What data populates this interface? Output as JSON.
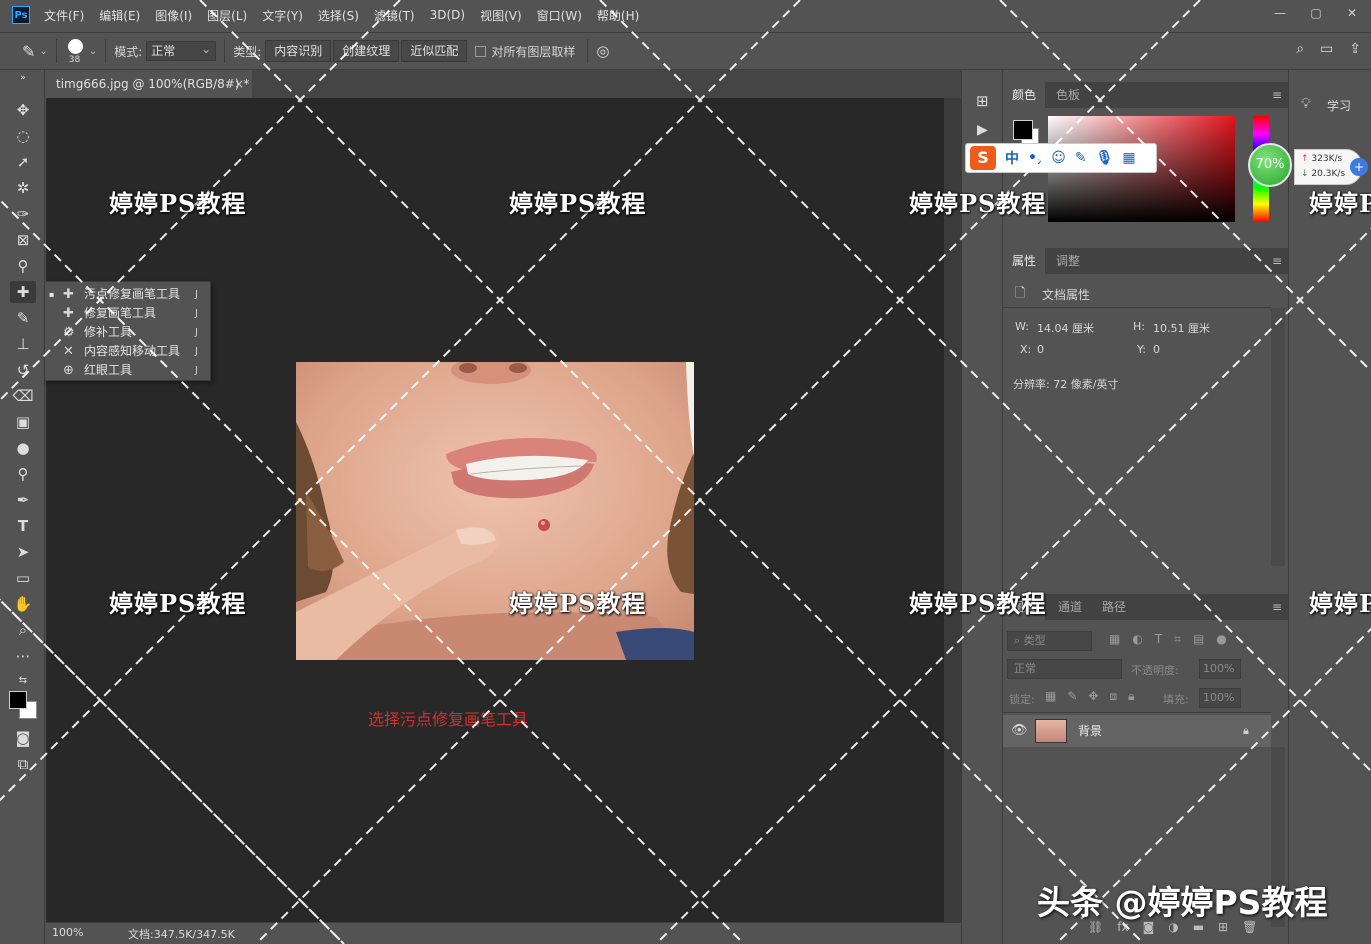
{
  "app": {
    "logo": "Ps",
    "menu": [
      "文件(F)",
      "编辑(E)",
      "图像(I)",
      "图层(L)",
      "文字(Y)",
      "选择(S)",
      "滤镜(T)",
      "3D(D)",
      "视图(V)",
      "窗口(W)",
      "帮助(H)"
    ],
    "window_controls": [
      "—",
      "▢",
      "✕"
    ]
  },
  "options": {
    "brush_size": "38",
    "mode_label": "模式:",
    "mode_value": "正常",
    "type_label": "类型:",
    "type_options": [
      "内容识别",
      "创建纹理",
      "近似匹配"
    ],
    "sample_all_label": "对所有图层取样"
  },
  "document": {
    "tab_title": "timg666.jpg @ 100%(RGB/8#) *",
    "close": "×",
    "zoom": "100%",
    "doc_size": "文档:347.5K/347.5K"
  },
  "flyout": {
    "items": [
      {
        "label": "污点修复画笔工具",
        "shortcut": "J",
        "selected": "▪"
      },
      {
        "label": "修复画笔工具",
        "shortcut": "J",
        "selected": ""
      },
      {
        "label": "修补工具",
        "shortcut": "J",
        "selected": ""
      },
      {
        "label": "内容感知移动工具",
        "shortcut": "J",
        "selected": ""
      },
      {
        "label": "红眼工具",
        "shortcut": "J",
        "selected": ""
      }
    ]
  },
  "caption": "选择污点修复画笔工具",
  "panels": {
    "color_tabs": [
      "颜色",
      "色板"
    ],
    "props_tabs": [
      "属性",
      "调整"
    ],
    "props_title": "文档属性",
    "width_label": "W:",
    "width_value": "14.04 厘米",
    "height_label": "H:",
    "height_value": "10.51 厘米",
    "x_label": "X:",
    "x_value": "0",
    "y_label": "Y:",
    "y_value": "0",
    "resolution": "分辨率: 72 像素/英寸",
    "layers_tabs": [
      "图层",
      "通道",
      "路径"
    ],
    "filter_placeholder": "类型",
    "blend_mode": "正常",
    "opacity_label": "不透明度:",
    "opacity_value": "100%",
    "lock_label": "锁定:",
    "fill_label": "填充:",
    "fill_value": "100%",
    "layer_name": "背景",
    "menu_icon": "≡"
  },
  "learn": {
    "label": "学习"
  },
  "ime": {
    "logo": "S",
    "lang": "中"
  },
  "network": {
    "percent": "70%",
    "up": "323K/s",
    "down": "20.3K/s",
    "plus": "+"
  },
  "watermark": {
    "text": "婷婷PS教程",
    "signature": "头条 @婷婷PS教程"
  }
}
